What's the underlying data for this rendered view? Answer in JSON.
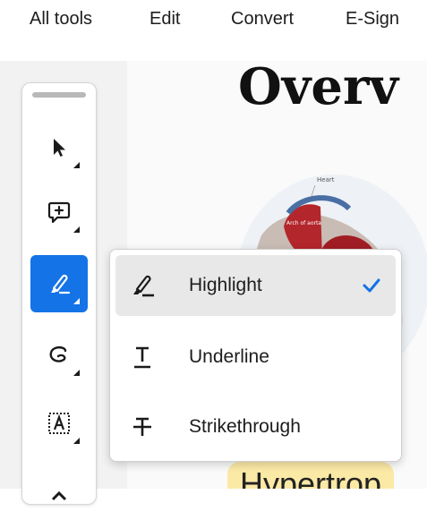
{
  "menubar": {
    "items": [
      {
        "label": "All tools"
      },
      {
        "label": "Edit"
      },
      {
        "label": "Convert"
      },
      {
        "label": "E-Sign"
      }
    ]
  },
  "document": {
    "title": "Overv",
    "figure_label_top": "Heart",
    "figure_label_mid": "Arch of aorta",
    "subtitle": "Hypertrop"
  },
  "toolbar": {
    "tools": [
      {
        "icon": "select-arrow-icon",
        "active": false
      },
      {
        "icon": "add-comment-icon",
        "active": false
      },
      {
        "icon": "highlight-pen-icon",
        "active": true
      },
      {
        "icon": "draw-freehand-icon",
        "active": false
      },
      {
        "icon": "text-select-icon",
        "active": false
      }
    ]
  },
  "markup_menu": {
    "items": [
      {
        "label": "Highlight",
        "icon": "highlighter-icon",
        "selected": true
      },
      {
        "label": "Underline",
        "icon": "underline-icon",
        "selected": false
      },
      {
        "label": "Strikethrough",
        "icon": "strikethrough-icon",
        "selected": false
      }
    ]
  },
  "colors": {
    "accent": "#1473e6",
    "highlight_bg": "#fbe9a6",
    "selected_item_bg": "#e8e8e8"
  }
}
